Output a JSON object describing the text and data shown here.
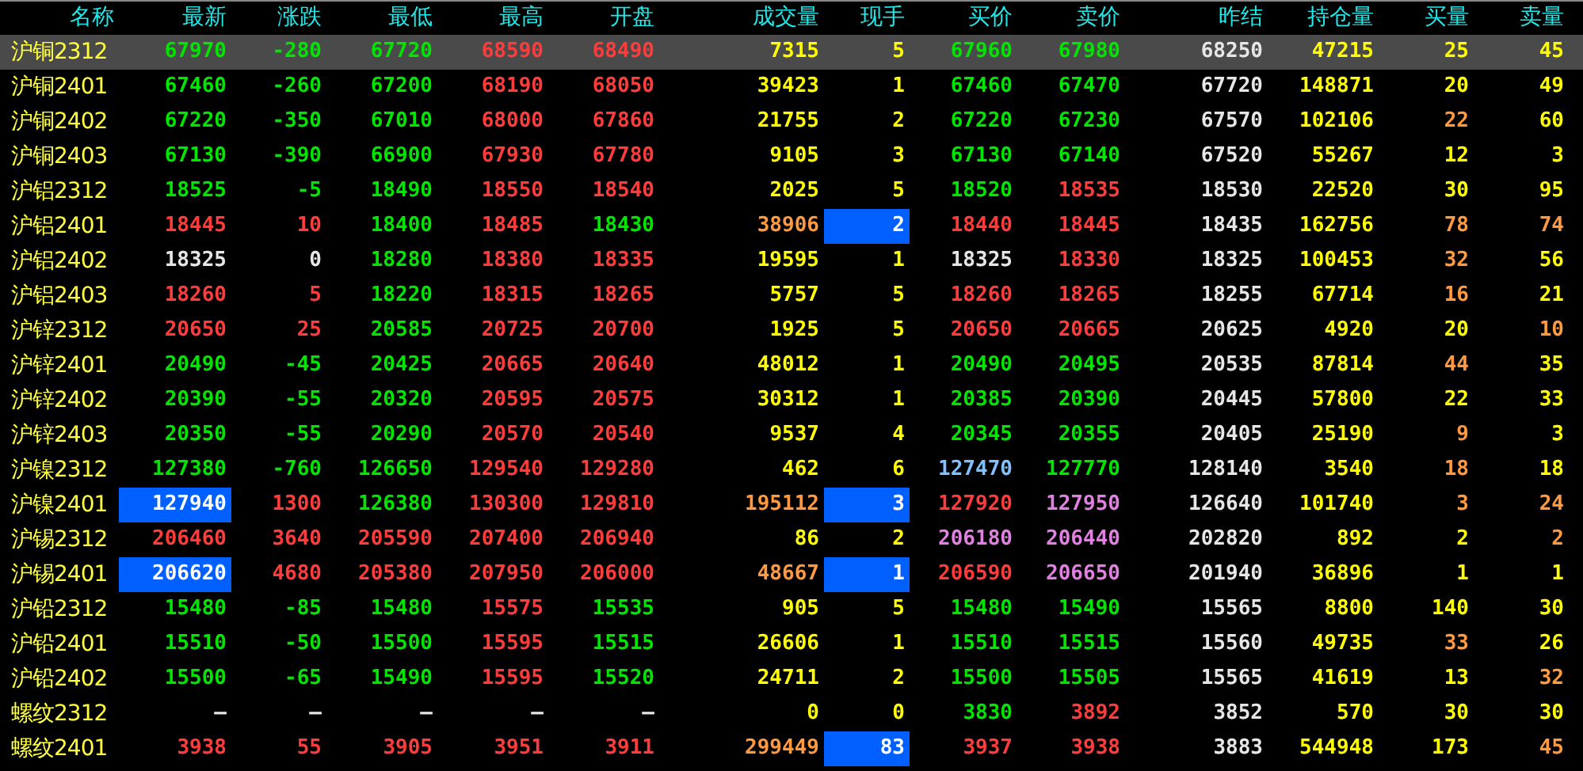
{
  "columns": [
    "名称",
    "最新",
    "涨跌",
    "最低",
    "最高",
    "开盘",
    "成交量",
    "现手",
    "买价",
    "卖价",
    "昨结",
    "持仓量",
    "买量",
    "卖量"
  ],
  "rows": [
    {
      "name": "沪铜2312",
      "selected": true,
      "cells": [
        {
          "text": "67970",
          "color": "#00e600",
          "highlighted": false
        },
        {
          "text": "-280",
          "color": "#00e600",
          "highlighted": false
        },
        {
          "text": "67720",
          "color": "#00e600",
          "highlighted": false
        },
        {
          "text": "68590",
          "color": "#ff3c3c",
          "highlighted": false
        },
        {
          "text": "68490",
          "color": "#ff3c3c",
          "highlighted": false
        },
        {
          "text": "7315",
          "color": "#ffff00",
          "highlighted": false
        },
        {
          "text": "5",
          "color": "#ffff00",
          "highlighted": false
        },
        {
          "text": "67960",
          "color": "#00e600",
          "highlighted": false
        },
        {
          "text": "67980",
          "color": "#00e600",
          "highlighted": false
        },
        {
          "text": "68250",
          "color": "#e6e6e6",
          "highlighted": false
        },
        {
          "text": "47215",
          "color": "#ffff00",
          "highlighted": false
        },
        {
          "text": "25",
          "color": "#ffff00",
          "highlighted": false
        },
        {
          "text": "45",
          "color": "#ffff00",
          "highlighted": false
        }
      ]
    },
    {
      "name": "沪铜2401",
      "selected": false,
      "cells": [
        {
          "text": "67460",
          "color": "#00e600",
          "highlighted": false
        },
        {
          "text": "-260",
          "color": "#00e600",
          "highlighted": false
        },
        {
          "text": "67200",
          "color": "#00e600",
          "highlighted": false
        },
        {
          "text": "68190",
          "color": "#ff3c3c",
          "highlighted": false
        },
        {
          "text": "68050",
          "color": "#ff3c3c",
          "highlighted": false
        },
        {
          "text": "39423",
          "color": "#ffff00",
          "highlighted": false
        },
        {
          "text": "1",
          "color": "#ffff00",
          "highlighted": false
        },
        {
          "text": "67460",
          "color": "#00e600",
          "highlighted": false
        },
        {
          "text": "67470",
          "color": "#00e600",
          "highlighted": false
        },
        {
          "text": "67720",
          "color": "#e6e6e6",
          "highlighted": false
        },
        {
          "text": "148871",
          "color": "#ffff00",
          "highlighted": false
        },
        {
          "text": "20",
          "color": "#ffff00",
          "highlighted": false
        },
        {
          "text": "49",
          "color": "#ffff00",
          "highlighted": false
        }
      ]
    },
    {
      "name": "沪铜2402",
      "selected": false,
      "cells": [
        {
          "text": "67220",
          "color": "#00e600",
          "highlighted": false
        },
        {
          "text": "-350",
          "color": "#00e600",
          "highlighted": false
        },
        {
          "text": "67010",
          "color": "#00e600",
          "highlighted": false
        },
        {
          "text": "68000",
          "color": "#ff3c3c",
          "highlighted": false
        },
        {
          "text": "67860",
          "color": "#ff3c3c",
          "highlighted": false
        },
        {
          "text": "21755",
          "color": "#ffff00",
          "highlighted": false
        },
        {
          "text": "2",
          "color": "#ffff00",
          "highlighted": false
        },
        {
          "text": "67220",
          "color": "#00e600",
          "highlighted": false
        },
        {
          "text": "67230",
          "color": "#00e600",
          "highlighted": false
        },
        {
          "text": "67570",
          "color": "#e6e6e6",
          "highlighted": false
        },
        {
          "text": "102106",
          "color": "#ffff00",
          "highlighted": false
        },
        {
          "text": "22",
          "color": "#ff9a40",
          "highlighted": false
        },
        {
          "text": "60",
          "color": "#ffff00",
          "highlighted": false
        }
      ]
    },
    {
      "name": "沪铜2403",
      "selected": false,
      "cells": [
        {
          "text": "67130",
          "color": "#00e600",
          "highlighted": false
        },
        {
          "text": "-390",
          "color": "#00e600",
          "highlighted": false
        },
        {
          "text": "66900",
          "color": "#00e600",
          "highlighted": false
        },
        {
          "text": "67930",
          "color": "#ff3c3c",
          "highlighted": false
        },
        {
          "text": "67780",
          "color": "#ff3c3c",
          "highlighted": false
        },
        {
          "text": "9105",
          "color": "#ffff00",
          "highlighted": false
        },
        {
          "text": "3",
          "color": "#ffff00",
          "highlighted": false
        },
        {
          "text": "67130",
          "color": "#00e600",
          "highlighted": false
        },
        {
          "text": "67140",
          "color": "#00e600",
          "highlighted": false
        },
        {
          "text": "67520",
          "color": "#e6e6e6",
          "highlighted": false
        },
        {
          "text": "55267",
          "color": "#ffff00",
          "highlighted": false
        },
        {
          "text": "12",
          "color": "#ffff00",
          "highlighted": false
        },
        {
          "text": "3",
          "color": "#ffff00",
          "highlighted": false
        }
      ]
    },
    {
      "name": "沪铝2312",
      "selected": false,
      "cells": [
        {
          "text": "18525",
          "color": "#00e600",
          "highlighted": false
        },
        {
          "text": "-5",
          "color": "#00e600",
          "highlighted": false
        },
        {
          "text": "18490",
          "color": "#00e600",
          "highlighted": false
        },
        {
          "text": "18550",
          "color": "#ff3c3c",
          "highlighted": false
        },
        {
          "text": "18540",
          "color": "#ff3c3c",
          "highlighted": false
        },
        {
          "text": "2025",
          "color": "#ffff00",
          "highlighted": false
        },
        {
          "text": "5",
          "color": "#ffff00",
          "highlighted": false
        },
        {
          "text": "18520",
          "color": "#00e600",
          "highlighted": false
        },
        {
          "text": "18535",
          "color": "#ff3c3c",
          "highlighted": false
        },
        {
          "text": "18530",
          "color": "#e6e6e6",
          "highlighted": false
        },
        {
          "text": "22520",
          "color": "#ffff00",
          "highlighted": false
        },
        {
          "text": "30",
          "color": "#ffff00",
          "highlighted": false
        },
        {
          "text": "95",
          "color": "#ffff00",
          "highlighted": false
        }
      ]
    },
    {
      "name": "沪铝2401",
      "selected": false,
      "cells": [
        {
          "text": "18445",
          "color": "#ff3c3c",
          "highlighted": false
        },
        {
          "text": "10",
          "color": "#ff3c3c",
          "highlighted": false
        },
        {
          "text": "18400",
          "color": "#00e600",
          "highlighted": false
        },
        {
          "text": "18485",
          "color": "#ff3c3c",
          "highlighted": false
        },
        {
          "text": "18430",
          "color": "#00e600",
          "highlighted": false
        },
        {
          "text": "38906",
          "color": "#ff9a40",
          "highlighted": false
        },
        {
          "text": "2",
          "color": "#0060ff",
          "highlighted": true
        },
        {
          "text": "18440",
          "color": "#ff3c3c",
          "highlighted": false
        },
        {
          "text": "18445",
          "color": "#ff3c3c",
          "highlighted": false
        },
        {
          "text": "18435",
          "color": "#e6e6e6",
          "highlighted": false
        },
        {
          "text": "162756",
          "color": "#ffff00",
          "highlighted": false
        },
        {
          "text": "78",
          "color": "#ff9a40",
          "highlighted": false
        },
        {
          "text": "74",
          "color": "#ff9a40",
          "highlighted": false
        }
      ]
    },
    {
      "name": "沪铝2402",
      "selected": false,
      "cells": [
        {
          "text": "18325",
          "color": "#e6e6e6",
          "highlighted": false
        },
        {
          "text": "0",
          "color": "#e6e6e6",
          "highlighted": false
        },
        {
          "text": "18280",
          "color": "#00e600",
          "highlighted": false
        },
        {
          "text": "18380",
          "color": "#ff3c3c",
          "highlighted": false
        },
        {
          "text": "18335",
          "color": "#ff3c3c",
          "highlighted": false
        },
        {
          "text": "19595",
          "color": "#ffff00",
          "highlighted": false
        },
        {
          "text": "1",
          "color": "#ffff00",
          "highlighted": false
        },
        {
          "text": "18325",
          "color": "#e6e6e6",
          "highlighted": false
        },
        {
          "text": "18330",
          "color": "#ff3c3c",
          "highlighted": false
        },
        {
          "text": "18325",
          "color": "#e6e6e6",
          "highlighted": false
        },
        {
          "text": "100453",
          "color": "#ffff00",
          "highlighted": false
        },
        {
          "text": "32",
          "color": "#ff9a40",
          "highlighted": false
        },
        {
          "text": "56",
          "color": "#ffff00",
          "highlighted": false
        }
      ]
    },
    {
      "name": "沪铝2403",
      "selected": false,
      "cells": [
        {
          "text": "18260",
          "color": "#ff3c3c",
          "highlighted": false
        },
        {
          "text": "5",
          "color": "#ff3c3c",
          "highlighted": false
        },
        {
          "text": "18220",
          "color": "#00e600",
          "highlighted": false
        },
        {
          "text": "18315",
          "color": "#ff3c3c",
          "highlighted": false
        },
        {
          "text": "18265",
          "color": "#ff3c3c",
          "highlighted": false
        },
        {
          "text": "5757",
          "color": "#ffff00",
          "highlighted": false
        },
        {
          "text": "5",
          "color": "#ffff00",
          "highlighted": false
        },
        {
          "text": "18260",
          "color": "#ff3c3c",
          "highlighted": false
        },
        {
          "text": "18265",
          "color": "#ff3c3c",
          "highlighted": false
        },
        {
          "text": "18255",
          "color": "#e6e6e6",
          "highlighted": false
        },
        {
          "text": "67714",
          "color": "#ffff00",
          "highlighted": false
        },
        {
          "text": "16",
          "color": "#ff9a40",
          "highlighted": false
        },
        {
          "text": "21",
          "color": "#ffff00",
          "highlighted": false
        }
      ]
    },
    {
      "name": "沪锌2312",
      "selected": false,
      "cells": [
        {
          "text": "20650",
          "color": "#ff3c3c",
          "highlighted": false
        },
        {
          "text": "25",
          "color": "#ff3c3c",
          "highlighted": false
        },
        {
          "text": "20585",
          "color": "#00e600",
          "highlighted": false
        },
        {
          "text": "20725",
          "color": "#ff3c3c",
          "highlighted": false
        },
        {
          "text": "20700",
          "color": "#ff3c3c",
          "highlighted": false
        },
        {
          "text": "1925",
          "color": "#ffff00",
          "highlighted": false
        },
        {
          "text": "5",
          "color": "#ffff00",
          "highlighted": false
        },
        {
          "text": "20650",
          "color": "#ff3c3c",
          "highlighted": false
        },
        {
          "text": "20665",
          "color": "#ff3c3c",
          "highlighted": false
        },
        {
          "text": "20625",
          "color": "#e6e6e6",
          "highlighted": false
        },
        {
          "text": "4920",
          "color": "#ffff00",
          "highlighted": false
        },
        {
          "text": "20",
          "color": "#ffff00",
          "highlighted": false
        },
        {
          "text": "10",
          "color": "#ff9a40",
          "highlighted": false
        }
      ]
    },
    {
      "name": "沪锌2401",
      "selected": false,
      "cells": [
        {
          "text": "20490",
          "color": "#00e600",
          "highlighted": false
        },
        {
          "text": "-45",
          "color": "#00e600",
          "highlighted": false
        },
        {
          "text": "20425",
          "color": "#00e600",
          "highlighted": false
        },
        {
          "text": "20665",
          "color": "#ff3c3c",
          "highlighted": false
        },
        {
          "text": "20640",
          "color": "#ff3c3c",
          "highlighted": false
        },
        {
          "text": "48012",
          "color": "#ffff00",
          "highlighted": false
        },
        {
          "text": "1",
          "color": "#ffff00",
          "highlighted": false
        },
        {
          "text": "20490",
          "color": "#00e600",
          "highlighted": false
        },
        {
          "text": "20495",
          "color": "#00e600",
          "highlighted": false
        },
        {
          "text": "20535",
          "color": "#e6e6e6",
          "highlighted": false
        },
        {
          "text": "87814",
          "color": "#ffff00",
          "highlighted": false
        },
        {
          "text": "44",
          "color": "#ff9a40",
          "highlighted": false
        },
        {
          "text": "35",
          "color": "#ffff00",
          "highlighted": false
        }
      ]
    },
    {
      "name": "沪锌2402",
      "selected": false,
      "cells": [
        {
          "text": "20390",
          "color": "#00e600",
          "highlighted": false
        },
        {
          "text": "-55",
          "color": "#00e600",
          "highlighted": false
        },
        {
          "text": "20320",
          "color": "#00e600",
          "highlighted": false
        },
        {
          "text": "20595",
          "color": "#ff3c3c",
          "highlighted": false
        },
        {
          "text": "20575",
          "color": "#ff3c3c",
          "highlighted": false
        },
        {
          "text": "30312",
          "color": "#ffff00",
          "highlighted": false
        },
        {
          "text": "1",
          "color": "#ffff00",
          "highlighted": false
        },
        {
          "text": "20385",
          "color": "#00e600",
          "highlighted": false
        },
        {
          "text": "20390",
          "color": "#00e600",
          "highlighted": false
        },
        {
          "text": "20445",
          "color": "#e6e6e6",
          "highlighted": false
        },
        {
          "text": "57800",
          "color": "#ffff00",
          "highlighted": false
        },
        {
          "text": "22",
          "color": "#ffff00",
          "highlighted": false
        },
        {
          "text": "33",
          "color": "#ffff00",
          "highlighted": false
        }
      ]
    },
    {
      "name": "沪锌2403",
      "selected": false,
      "cells": [
        {
          "text": "20350",
          "color": "#00e600",
          "highlighted": false
        },
        {
          "text": "-55",
          "color": "#00e600",
          "highlighted": false
        },
        {
          "text": "20290",
          "color": "#00e600",
          "highlighted": false
        },
        {
          "text": "20570",
          "color": "#ff3c3c",
          "highlighted": false
        },
        {
          "text": "20540",
          "color": "#ff3c3c",
          "highlighted": false
        },
        {
          "text": "9537",
          "color": "#ffff00",
          "highlighted": false
        },
        {
          "text": "4",
          "color": "#ffff00",
          "highlighted": false
        },
        {
          "text": "20345",
          "color": "#00e600",
          "highlighted": false
        },
        {
          "text": "20355",
          "color": "#00e600",
          "highlighted": false
        },
        {
          "text": "20405",
          "color": "#e6e6e6",
          "highlighted": false
        },
        {
          "text": "25190",
          "color": "#ffff00",
          "highlighted": false
        },
        {
          "text": "9",
          "color": "#ff9a40",
          "highlighted": false
        },
        {
          "text": "3",
          "color": "#ffff00",
          "highlighted": false
        }
      ]
    },
    {
      "name": "沪镍2312",
      "selected": false,
      "cells": [
        {
          "text": "127380",
          "color": "#00e600",
          "highlighted": false
        },
        {
          "text": "-760",
          "color": "#00e600",
          "highlighted": false
        },
        {
          "text": "126650",
          "color": "#00e600",
          "highlighted": false
        },
        {
          "text": "129540",
          "color": "#ff3c3c",
          "highlighted": false
        },
        {
          "text": "129280",
          "color": "#ff3c3c",
          "highlighted": false
        },
        {
          "text": "462",
          "color": "#ffff00",
          "highlighted": false
        },
        {
          "text": "6",
          "color": "#ffff00",
          "highlighted": false
        },
        {
          "text": "127470",
          "color": "#80c0ff",
          "highlighted": false
        },
        {
          "text": "127770",
          "color": "#00e600",
          "highlighted": false
        },
        {
          "text": "128140",
          "color": "#e6e6e6",
          "highlighted": false
        },
        {
          "text": "3540",
          "color": "#ffff00",
          "highlighted": false
        },
        {
          "text": "18",
          "color": "#ff9a40",
          "highlighted": false
        },
        {
          "text": "18",
          "color": "#ffff00",
          "highlighted": false
        }
      ]
    },
    {
      "name": "沪镍2401",
      "selected": false,
      "cells": [
        {
          "text": "127940",
          "color": "#0060ff",
          "highlighted": true
        },
        {
          "text": "1300",
          "color": "#ff3c3c",
          "highlighted": false
        },
        {
          "text": "126380",
          "color": "#00e600",
          "highlighted": false
        },
        {
          "text": "130300",
          "color": "#ff3c3c",
          "highlighted": false
        },
        {
          "text": "129810",
          "color": "#ff3c3c",
          "highlighted": false
        },
        {
          "text": "195112",
          "color": "#ff9a40",
          "highlighted": false
        },
        {
          "text": "3",
          "color": "#0060ff",
          "highlighted": true
        },
        {
          "text": "127920",
          "color": "#ff3c3c",
          "highlighted": false
        },
        {
          "text": "127950",
          "color": "#e080e0",
          "highlighted": false
        },
        {
          "text": "126640",
          "color": "#e6e6e6",
          "highlighted": false
        },
        {
          "text": "101740",
          "color": "#ffff00",
          "highlighted": false
        },
        {
          "text": "3",
          "color": "#ff9a40",
          "highlighted": false
        },
        {
          "text": "24",
          "color": "#ff9a40",
          "highlighted": false
        }
      ]
    },
    {
      "name": "沪锡2312",
      "selected": false,
      "cells": [
        {
          "text": "206460",
          "color": "#ff3c3c",
          "highlighted": false
        },
        {
          "text": "3640",
          "color": "#ff3c3c",
          "highlighted": false
        },
        {
          "text": "205590",
          "color": "#ff3c3c",
          "highlighted": false
        },
        {
          "text": "207400",
          "color": "#ff3c3c",
          "highlighted": false
        },
        {
          "text": "206940",
          "color": "#ff3c3c",
          "highlighted": false
        },
        {
          "text": "86",
          "color": "#ffff00",
          "highlighted": false
        },
        {
          "text": "2",
          "color": "#ffff00",
          "highlighted": false
        },
        {
          "text": "206180",
          "color": "#e080e0",
          "highlighted": false
        },
        {
          "text": "206440",
          "color": "#e080e0",
          "highlighted": false
        },
        {
          "text": "202820",
          "color": "#e6e6e6",
          "highlighted": false
        },
        {
          "text": "892",
          "color": "#ffff00",
          "highlighted": false
        },
        {
          "text": "2",
          "color": "#ffff00",
          "highlighted": false
        },
        {
          "text": "2",
          "color": "#ff9a40",
          "highlighted": false
        }
      ]
    },
    {
      "name": "沪锡2401",
      "selected": false,
      "cells": [
        {
          "text": "206620",
          "color": "#0060ff",
          "highlighted": true
        },
        {
          "text": "4680",
          "color": "#ff3c3c",
          "highlighted": false
        },
        {
          "text": "205380",
          "color": "#ff3c3c",
          "highlighted": false
        },
        {
          "text": "207950",
          "color": "#ff3c3c",
          "highlighted": false
        },
        {
          "text": "206000",
          "color": "#ff3c3c",
          "highlighted": false
        },
        {
          "text": "48667",
          "color": "#ff9a40",
          "highlighted": false
        },
        {
          "text": "1",
          "color": "#0060ff",
          "highlighted": true
        },
        {
          "text": "206590",
          "color": "#ff3c3c",
          "highlighted": false
        },
        {
          "text": "206650",
          "color": "#e080e0",
          "highlighted": false
        },
        {
          "text": "201940",
          "color": "#e6e6e6",
          "highlighted": false
        },
        {
          "text": "36896",
          "color": "#ffff00",
          "highlighted": false
        },
        {
          "text": "1",
          "color": "#ffff00",
          "highlighted": false
        },
        {
          "text": "1",
          "color": "#ffff00",
          "highlighted": false
        }
      ]
    },
    {
      "name": "沪铅2312",
      "selected": false,
      "cells": [
        {
          "text": "15480",
          "color": "#00e600",
          "highlighted": false
        },
        {
          "text": "-85",
          "color": "#00e600",
          "highlighted": false
        },
        {
          "text": "15480",
          "color": "#00e600",
          "highlighted": false
        },
        {
          "text": "15575",
          "color": "#ff3c3c",
          "highlighted": false
        },
        {
          "text": "15535",
          "color": "#00e600",
          "highlighted": false
        },
        {
          "text": "905",
          "color": "#ffff00",
          "highlighted": false
        },
        {
          "text": "5",
          "color": "#ffff00",
          "highlighted": false
        },
        {
          "text": "15480",
          "color": "#00e600",
          "highlighted": false
        },
        {
          "text": "15490",
          "color": "#00e600",
          "highlighted": false
        },
        {
          "text": "15565",
          "color": "#e6e6e6",
          "highlighted": false
        },
        {
          "text": "8800",
          "color": "#ffff00",
          "highlighted": false
        },
        {
          "text": "140",
          "color": "#ffff00",
          "highlighted": false
        },
        {
          "text": "30",
          "color": "#ffff00",
          "highlighted": false
        }
      ]
    },
    {
      "name": "沪铅2401",
      "selected": false,
      "cells": [
        {
          "text": "15510",
          "color": "#00e600",
          "highlighted": false
        },
        {
          "text": "-50",
          "color": "#00e600",
          "highlighted": false
        },
        {
          "text": "15500",
          "color": "#00e600",
          "highlighted": false
        },
        {
          "text": "15595",
          "color": "#ff3c3c",
          "highlighted": false
        },
        {
          "text": "15515",
          "color": "#00e600",
          "highlighted": false
        },
        {
          "text": "26606",
          "color": "#ffff00",
          "highlighted": false
        },
        {
          "text": "1",
          "color": "#ffff00",
          "highlighted": false
        },
        {
          "text": "15510",
          "color": "#00e600",
          "highlighted": false
        },
        {
          "text": "15515",
          "color": "#00e600",
          "highlighted": false
        },
        {
          "text": "15560",
          "color": "#e6e6e6",
          "highlighted": false
        },
        {
          "text": "49735",
          "color": "#ffff00",
          "highlighted": false
        },
        {
          "text": "33",
          "color": "#ff9a40",
          "highlighted": false
        },
        {
          "text": "26",
          "color": "#ffff00",
          "highlighted": false
        }
      ]
    },
    {
      "name": "沪铅2402",
      "selected": false,
      "cells": [
        {
          "text": "15500",
          "color": "#00e600",
          "highlighted": false
        },
        {
          "text": "-65",
          "color": "#00e600",
          "highlighted": false
        },
        {
          "text": "15490",
          "color": "#00e600",
          "highlighted": false
        },
        {
          "text": "15595",
          "color": "#ff3c3c",
          "highlighted": false
        },
        {
          "text": "15520",
          "color": "#00e600",
          "highlighted": false
        },
        {
          "text": "24711",
          "color": "#ffff00",
          "highlighted": false
        },
        {
          "text": "2",
          "color": "#ffff00",
          "highlighted": false
        },
        {
          "text": "15500",
          "color": "#00e600",
          "highlighted": false
        },
        {
          "text": "15505",
          "color": "#00e600",
          "highlighted": false
        },
        {
          "text": "15565",
          "color": "#e6e6e6",
          "highlighted": false
        },
        {
          "text": "41619",
          "color": "#ffff00",
          "highlighted": false
        },
        {
          "text": "13",
          "color": "#ffff00",
          "highlighted": false
        },
        {
          "text": "32",
          "color": "#ff9a40",
          "highlighted": false
        }
      ]
    },
    {
      "name": "螺纹2312",
      "selected": false,
      "cells": [
        {
          "text": "—",
          "color": "#e6e6e6",
          "highlighted": false
        },
        {
          "text": "—",
          "color": "#e6e6e6",
          "highlighted": false
        },
        {
          "text": "—",
          "color": "#e6e6e6",
          "highlighted": false
        },
        {
          "text": "—",
          "color": "#e6e6e6",
          "highlighted": false
        },
        {
          "text": "—",
          "color": "#e6e6e6",
          "highlighted": false
        },
        {
          "text": "0",
          "color": "#ffff00",
          "highlighted": false
        },
        {
          "text": "0",
          "color": "#ffff00",
          "highlighted": false
        },
        {
          "text": "3830",
          "color": "#00e600",
          "highlighted": false
        },
        {
          "text": "3892",
          "color": "#ff3c3c",
          "highlighted": false
        },
        {
          "text": "3852",
          "color": "#e6e6e6",
          "highlighted": false
        },
        {
          "text": "570",
          "color": "#ffff00",
          "highlighted": false
        },
        {
          "text": "30",
          "color": "#ffff00",
          "highlighted": false
        },
        {
          "text": "30",
          "color": "#ffff00",
          "highlighted": false
        }
      ]
    },
    {
      "name": "螺纹2401",
      "selected": false,
      "cells": [
        {
          "text": "3938",
          "color": "#ff3c3c",
          "highlighted": false
        },
        {
          "text": "55",
          "color": "#ff3c3c",
          "highlighted": false
        },
        {
          "text": "3905",
          "color": "#ff3c3c",
          "highlighted": false
        },
        {
          "text": "3951",
          "color": "#ff3c3c",
          "highlighted": false
        },
        {
          "text": "3911",
          "color": "#ff3c3c",
          "highlighted": false
        },
        {
          "text": "299449",
          "color": "#ff9a40",
          "highlighted": false
        },
        {
          "text": "83",
          "color": "#0060ff",
          "highlighted": true
        },
        {
          "text": "3937",
          "color": "#ff3c3c",
          "highlighted": false
        },
        {
          "text": "3938",
          "color": "#ff3c3c",
          "highlighted": false
        },
        {
          "text": "3883",
          "color": "#e6e6e6",
          "highlighted": false
        },
        {
          "text": "544948",
          "color": "#ffff00",
          "highlighted": false
        },
        {
          "text": "173",
          "color": "#ffff00",
          "highlighted": false
        },
        {
          "text": "45",
          "color": "#ff9a40",
          "highlighted": false
        }
      ]
    }
  ]
}
